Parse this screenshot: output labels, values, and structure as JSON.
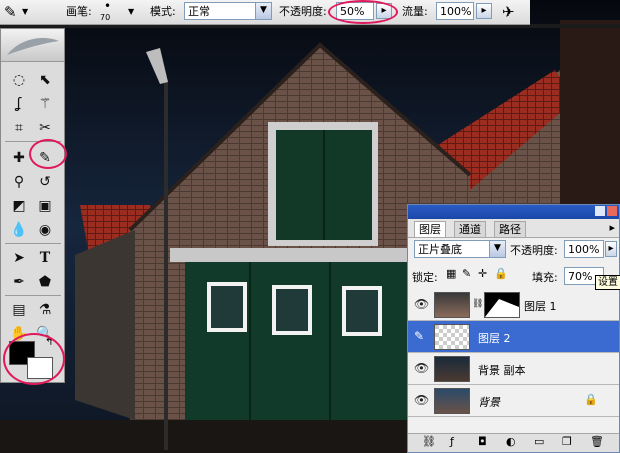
{
  "options_bar": {
    "brush_label": "画笔:",
    "brush_size": "70",
    "mode_label": "模式:",
    "mode_value": "正常",
    "opacity_label": "不透明度:",
    "opacity_value": "50%",
    "flow_label": "流量:",
    "flow_value": "100%"
  },
  "tools": [
    "marquee",
    "move",
    "lasso",
    "magic-wand",
    "crop",
    "slice",
    "healing-brush",
    "brush",
    "clone-stamp",
    "history-brush",
    "eraser",
    "gradient",
    "blur",
    "dodge",
    "path-selection",
    "type",
    "pen",
    "shape",
    "notes",
    "eyedropper",
    "hand",
    "zoom"
  ],
  "type_tool_glyph": "T",
  "layers_panel": {
    "tabs": [
      "图层",
      "通道",
      "路径"
    ],
    "blend_mode": "正片叠底",
    "opacity_label": "不透明度:",
    "opacity_value": "100%",
    "lock_label": "锁定:",
    "fill_label": "填充:",
    "fill_value": "70%",
    "layers": [
      {
        "name": "图层 1",
        "selected": false
      },
      {
        "name": "图层 2",
        "selected": true
      },
      {
        "name": "背景 副本",
        "selected": false
      },
      {
        "name": "背景",
        "selected": false
      }
    ]
  },
  "tooltip": "设置",
  "colors": {
    "highlight": "#e0185c",
    "selection": "#3b6bd1",
    "foreground": "#000000",
    "background": "#ffffff"
  }
}
